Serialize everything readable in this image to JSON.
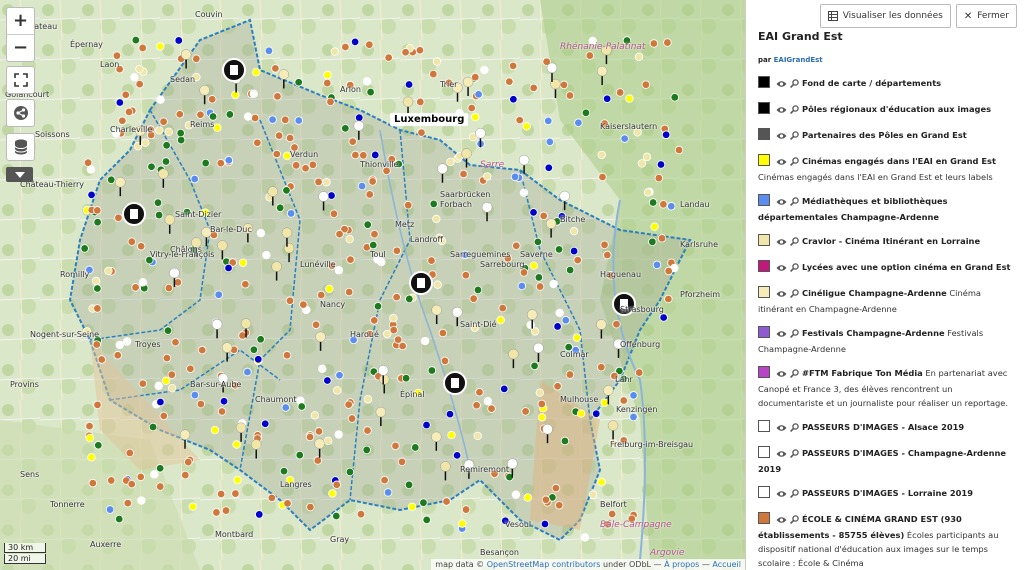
{
  "map": {
    "controls": {
      "zoom_in": "+",
      "zoom_out": "−"
    },
    "luxembourg_label": "Luxembourg",
    "cities": [
      "Couvin",
      "Golancourt",
      "Neufchateau",
      "Arlon",
      "Trier",
      "Saarbrücken",
      "Sarre",
      "Kaiserslautern",
      "Rhénanie-Palatinat",
      "Metz",
      "Nancy",
      "Strasbourg",
      "Colmar",
      "Mulhouse",
      "Épinal",
      "Reims",
      "Châlons",
      "Troyes",
      "Chaumont",
      "Bar-le-Duc",
      "Verdun",
      "Sedan",
      "Charleville",
      "Freiburg-im-Breisgau",
      "Offenburg",
      "Lahr",
      "Kenzingen",
      "Karlsruhe",
      "Pforzheim",
      "Landau",
      "Bitche",
      "Haguenau",
      "Saverne",
      "Sarrebourg",
      "Lunéville",
      "Saint-Dié",
      "Remiremont",
      "Vesoul",
      "Langres",
      "Belfort",
      "Bar-sur-Aube",
      "Vitry-le-François",
      "Saint-Dizier",
      "Toul",
      "Épernay",
      "Soissons",
      "Château-Thierry",
      "Laon",
      "Thionville",
      "Forbach",
      "Sarreguemines",
      "Landroff",
      "Haroué",
      "Montbard",
      "Gray",
      "Besançon",
      "Bâle-Campagne",
      "Argovie",
      "Tonnerre",
      "Auxerre",
      "Sens",
      "Provins",
      "Nogent-sur-Seine",
      "Romilly"
    ],
    "scale": {
      "top": "30 km",
      "bottom": "20 mi"
    },
    "attribution": {
      "prefix": "map data ©",
      "osm": "OpenStreetMap contributors",
      "license": "under ODbL",
      "sep": "—",
      "about": "À propos",
      "sep2": "—",
      "home": "Accueil"
    }
  },
  "panel": {
    "btn_data": "Visualiser les données",
    "btn_close": "Fermer",
    "title": "EAI Grand Est",
    "by_prefix": "par",
    "by_user": "EAIGrandEst",
    "layers": [
      {
        "color": "#000000",
        "name": "Fond de carte / départements",
        "desc": ""
      },
      {
        "color": "#000000",
        "name": "Pôles régionaux d'éducation aux images",
        "desc": ""
      },
      {
        "color": "#555555",
        "name": "Partenaires des Pôles en Grand Est",
        "desc": ""
      },
      {
        "color": "#ffff00",
        "name": "Cinémas engagés dans l'EAI en Grand Est",
        "desc": "Cinémas engagés dans l'EAI en Grand Est et leurs labels"
      },
      {
        "color": "#5b8def",
        "name": "Médiathèques et bibliothèques départementales Champagne-Ardenne",
        "desc": ""
      },
      {
        "color": "#f0e6a8",
        "name": "Cravlor - Cinéma Itinérant en Lorraine",
        "desc": ""
      },
      {
        "color": "#c2187a",
        "name": "Lycées avec une option cinéma en Grand Est",
        "desc": ""
      },
      {
        "color": "#f5ecb8",
        "name": "Cinéligue Champagne-Ardenne",
        "desc": "Cinéma itinérant en Champagne-Ardenne"
      },
      {
        "color": "#8e5bd0",
        "name": "Festivals Champagne-Ardenne",
        "desc": "Festivals Champagne-Ardenne"
      },
      {
        "color": "#b844c8",
        "name": "#FTM Fabrique Ton Média",
        "desc": "En partenariat avec Canopé et France 3, des élèves rencontrent un documentariste et un journaliste pour réaliser un reportage."
      },
      {
        "color": "#ffffff",
        "name": "PASSEURS D'IMAGES - Alsace 2019",
        "desc": ""
      },
      {
        "color": "#ffffff",
        "name": "PASSEURS D'IMAGES - Champagne-Ardenne 2019",
        "desc": ""
      },
      {
        "color": "#ffffff",
        "name": "PASSEURS D'IMAGES - Lorraine 2019",
        "desc": ""
      },
      {
        "color": "#d0773b",
        "name": "ÉCOLE & CINÉMA GRAND EST (930 établissements - 85755 élèves)",
        "desc": "Écoles participants au dispositif national d'éducation aux images sur le temps scolaire : École & Cinéma"
      }
    ]
  }
}
